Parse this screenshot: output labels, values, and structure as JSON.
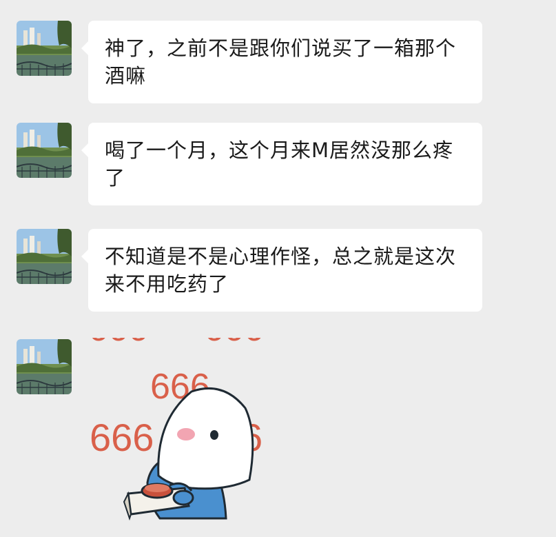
{
  "messages": [
    {
      "sender": "contact",
      "text": "神了，之前不是跟你们说买了一箱那个酒嘛"
    },
    {
      "sender": "contact",
      "text": "喝了一个月，这个月来M居然没那么疼了"
    },
    {
      "sender": "contact",
      "text": "不知道是不是心理作怪，总之就是这次来不用吃药了"
    }
  ],
  "sticker": {
    "label": "666",
    "icon": "ghost-holding-button-sticker"
  },
  "colors": {
    "background": "#ededed",
    "bubble": "#ffffff",
    "text": "#1a1a1a",
    "sticker_red": "#d9604a",
    "sticker_blue": "#4a90cf"
  }
}
